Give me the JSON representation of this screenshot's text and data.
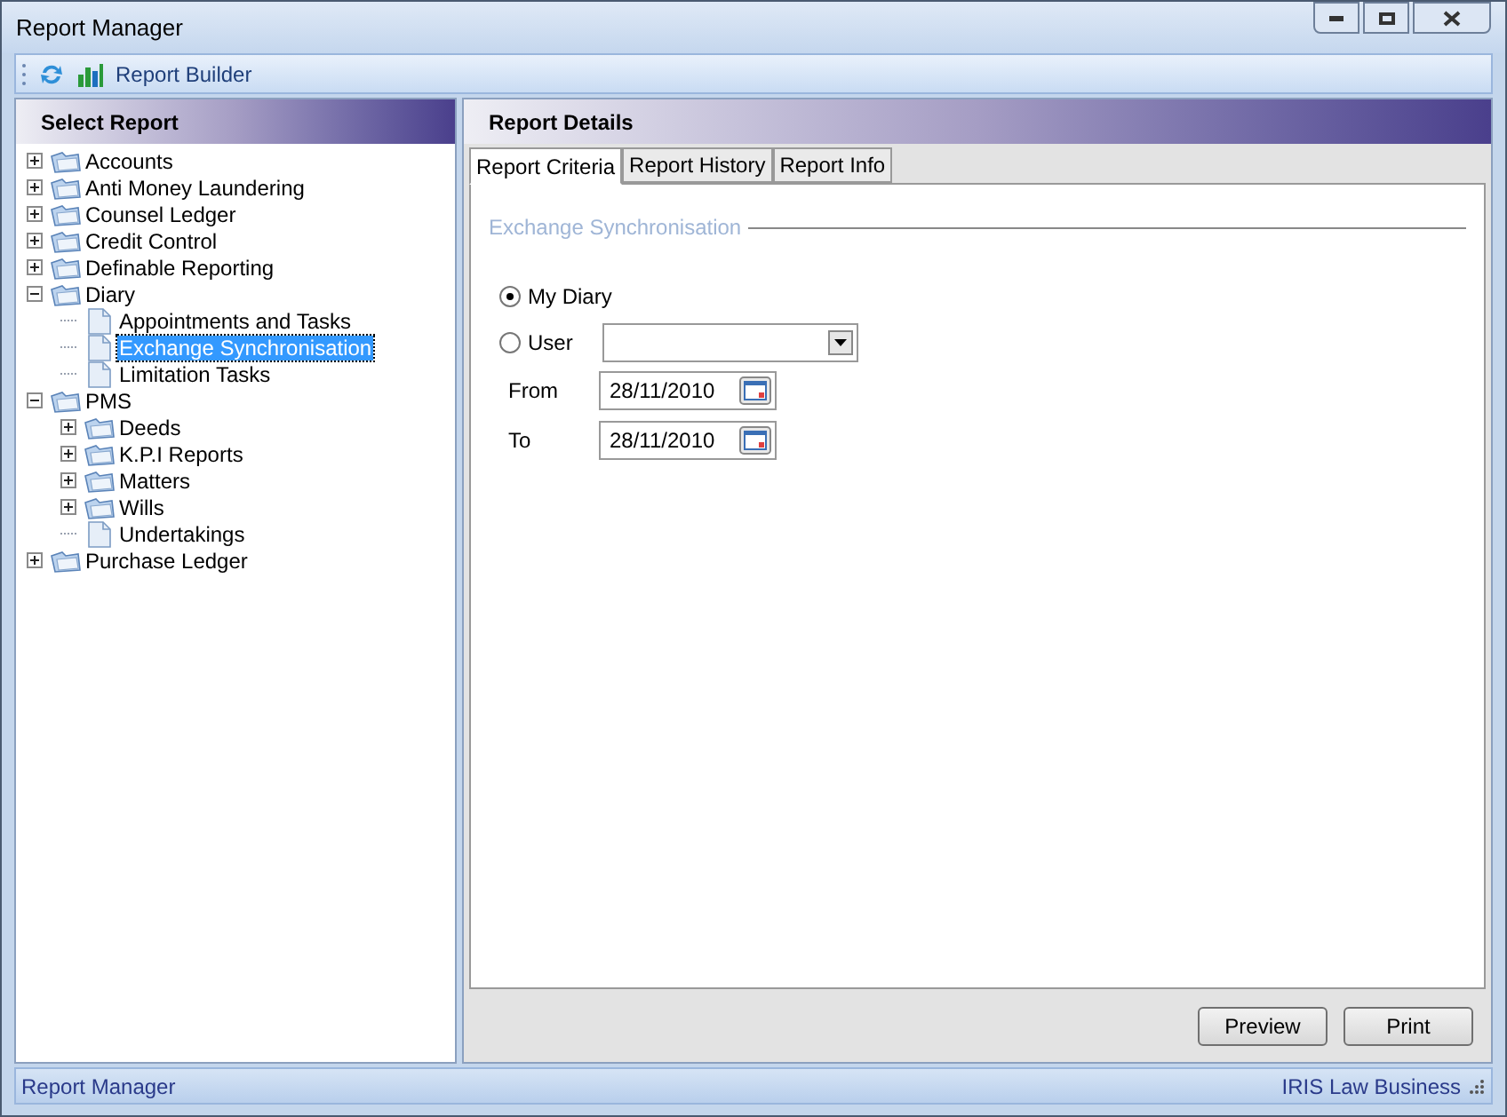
{
  "window": {
    "title": "Report Manager"
  },
  "toolbar": {
    "items": [
      {
        "kind": "refresh"
      },
      {
        "kind": "builder",
        "label": "Report Builder"
      }
    ]
  },
  "left_panel": {
    "title": "Select Report"
  },
  "tree": [
    {
      "label": "Accounts",
      "kind": "folder",
      "expanded": false,
      "selected": false
    },
    {
      "label": "Anti Money Laundering",
      "kind": "folder",
      "expanded": false,
      "selected": false
    },
    {
      "label": "Counsel Ledger",
      "kind": "folder",
      "expanded": false,
      "selected": false
    },
    {
      "label": "Credit Control",
      "kind": "folder",
      "expanded": false,
      "selected": false
    },
    {
      "label": "Definable Reporting",
      "kind": "folder",
      "expanded": false,
      "selected": false
    },
    {
      "label": "Diary",
      "kind": "folder",
      "expanded": true,
      "selected": false,
      "children": [
        {
          "label": "Appointments and Tasks",
          "kind": "report",
          "selected": false
        },
        {
          "label": "Exchange Synchronisation",
          "kind": "report",
          "selected": true
        },
        {
          "label": "Limitation Tasks",
          "kind": "report",
          "selected": false
        }
      ]
    },
    {
      "label": "PMS",
      "kind": "folder",
      "expanded": true,
      "selected": false,
      "children": [
        {
          "label": "Deeds",
          "kind": "folder",
          "expanded": false,
          "selected": false
        },
        {
          "label": "K.P.I Reports",
          "kind": "folder",
          "expanded": false,
          "selected": false
        },
        {
          "label": "Matters",
          "kind": "folder",
          "expanded": false,
          "selected": false
        },
        {
          "label": "Wills",
          "kind": "folder",
          "expanded": false,
          "selected": false
        },
        {
          "label": "Undertakings",
          "kind": "report",
          "selected": false
        }
      ]
    },
    {
      "label": "Purchase Ledger",
      "kind": "folder",
      "expanded": false,
      "selected": false
    }
  ],
  "right_panel": {
    "title": "Report Details"
  },
  "tabs": [
    {
      "label": "Report Criteria",
      "selected": true
    },
    {
      "label": "Report History",
      "selected": false
    },
    {
      "label": "Report Info",
      "selected": false
    }
  ],
  "criteria": {
    "group_title": "Exchange Synchronisation",
    "options": [
      {
        "label": "My Diary",
        "selected": true
      },
      {
        "label": "User",
        "selected": false
      }
    ],
    "dates": [
      {
        "label": "From",
        "value": "28/11/2010"
      },
      {
        "label": "To",
        "value": "28/11/2010"
      }
    ]
  },
  "buttons": [
    "Preview",
    "Print"
  ],
  "status_bar": {
    "left": "Report Manager",
    "right": "IRIS Law Business"
  }
}
